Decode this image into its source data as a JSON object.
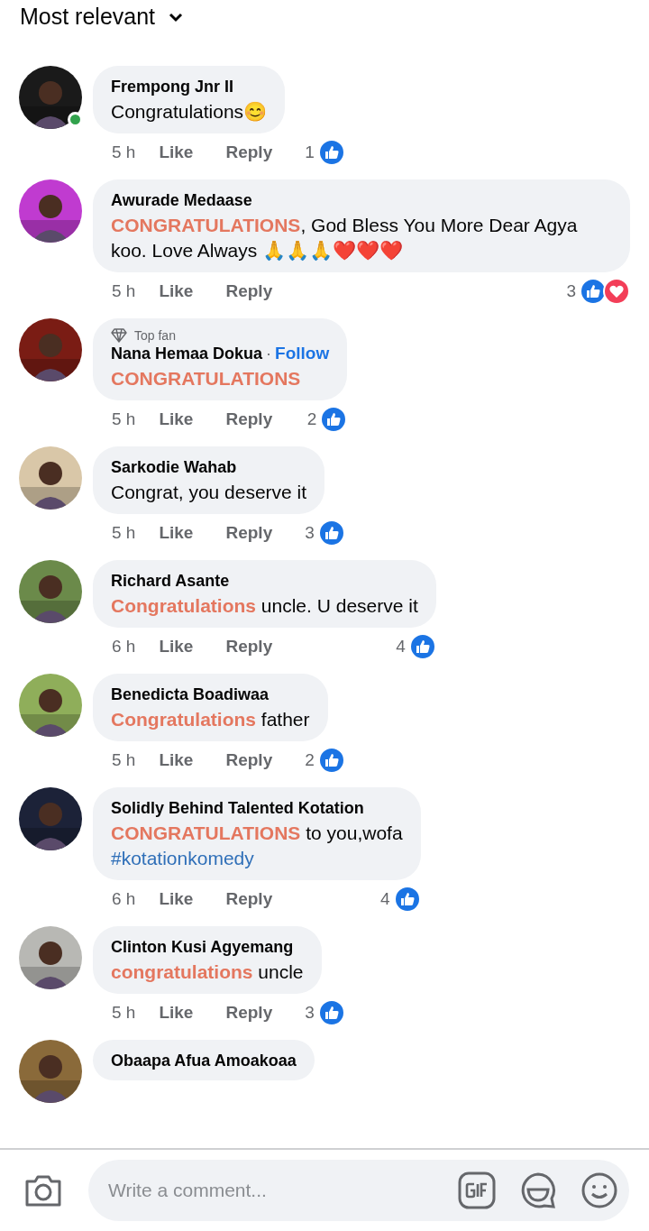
{
  "sort": {
    "label": "Most relevant"
  },
  "comments": [
    {
      "author": "Frempong Jnr II",
      "online": true,
      "body": [
        {
          "kind": "plain",
          "text": "Congratulations😊"
        }
      ],
      "time": "5 h",
      "like": "Like",
      "reply": "Reply",
      "reaction_count": "1",
      "reactions": [
        {
          "kind": "like"
        }
      ]
    },
    {
      "author": "Awurade Medaase",
      "online": false,
      "body": [
        {
          "kind": "highlight",
          "text": "CONGRATULATIONS"
        },
        {
          "kind": "plain",
          "text": ", God Bless You More Dear Agya koo. Love Always 🙏🙏🙏❤️❤️❤️"
        }
      ],
      "time": "5 h",
      "like": "Like",
      "reply": "Reply",
      "reaction_count": "3",
      "reactions": [
        {
          "kind": "like"
        },
        {
          "kind": "love"
        }
      ]
    },
    {
      "author": "Nana Hemaa Dokua",
      "online": false,
      "top_fan": "Top fan",
      "separator": "·",
      "follow": "Follow",
      "body": [
        {
          "kind": "highlight",
          "text": "CONGRATULATIONS"
        }
      ],
      "time": "5 h",
      "like": "Like",
      "reply": "Reply",
      "reaction_count": "2",
      "reactions": [
        {
          "kind": "like"
        }
      ]
    },
    {
      "author": "Sarkodie Wahab",
      "online": false,
      "body": [
        {
          "kind": "plain",
          "text": "Congrat, you deserve it"
        }
      ],
      "time": "5 h",
      "like": "Like",
      "reply": "Reply",
      "reaction_count": "3",
      "reactions": [
        {
          "kind": "like"
        }
      ]
    },
    {
      "author": "Richard Asante",
      "online": false,
      "body": [
        {
          "kind": "highlight",
          "text": "Congratulations"
        },
        {
          "kind": "plain",
          "text": " uncle. U deserve it"
        }
      ],
      "time": "6 h",
      "like": "Like",
      "reply": "Reply",
      "reaction_count": "4",
      "reactions": [
        {
          "kind": "like"
        }
      ]
    },
    {
      "author": "Benedicta Boadiwaa",
      "online": false,
      "body": [
        {
          "kind": "highlight",
          "text": "Congratulations"
        },
        {
          "kind": "plain",
          "text": " father"
        }
      ],
      "time": "5 h",
      "like": "Like",
      "reply": "Reply",
      "reaction_count": "2",
      "reactions": [
        {
          "kind": "like"
        }
      ]
    },
    {
      "author": "Solidly Behind Talented Kotation",
      "online": false,
      "body": [
        {
          "kind": "highlight",
          "text": "CONGRATULATIONS"
        },
        {
          "kind": "plain",
          "text": " to you,wofa"
        },
        {
          "kind": "hashtag",
          "text": "#kotationkomedy"
        }
      ],
      "time": "6 h",
      "like": "Like",
      "reply": "Reply",
      "reaction_count": "4",
      "reactions": [
        {
          "kind": "like"
        }
      ]
    },
    {
      "author": "Clinton Kusi Agyemang",
      "online": false,
      "body": [
        {
          "kind": "highlight",
          "text": "congratulations"
        },
        {
          "kind": "plain",
          "text": " uncle"
        }
      ],
      "time": "5 h",
      "like": "Like",
      "reply": "Reply",
      "reaction_count": "3",
      "reactions": [
        {
          "kind": "like"
        }
      ]
    },
    {
      "author": "Obaapa Afua Amoakoaa",
      "online": false
    }
  ],
  "composer": {
    "placeholder": "Write a comment..."
  }
}
